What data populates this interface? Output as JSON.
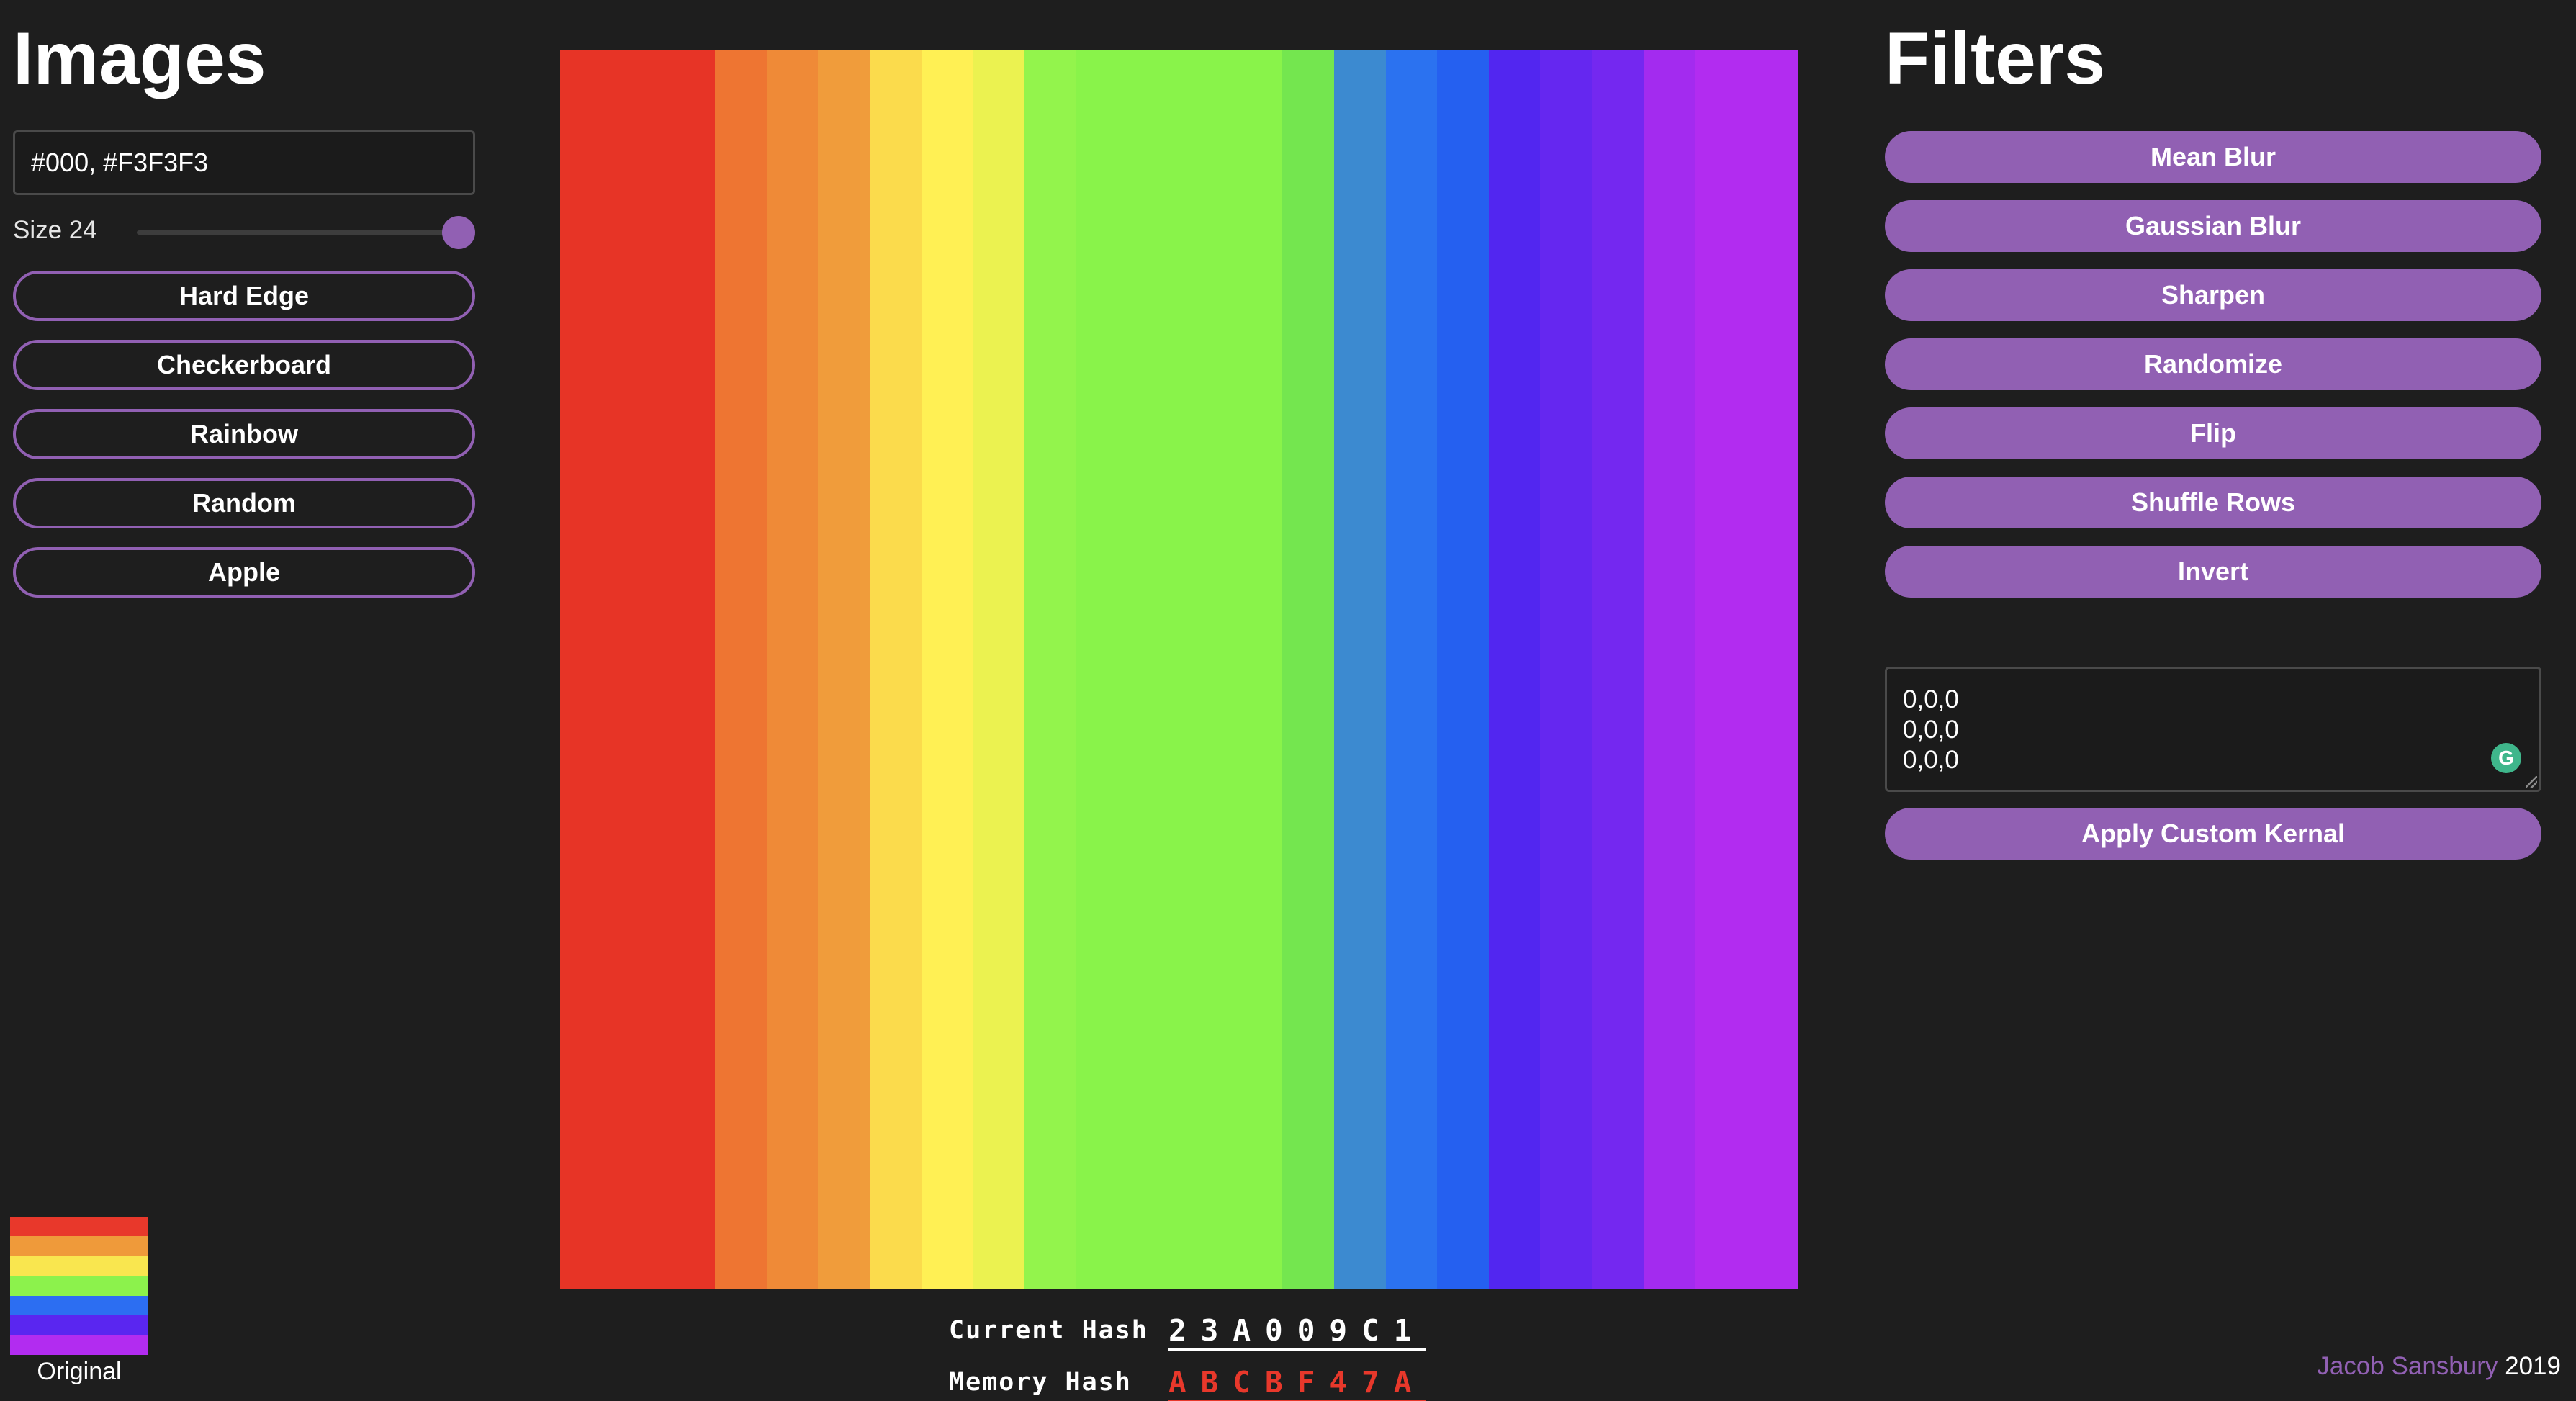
{
  "images_panel": {
    "title": "Images",
    "color_input_value": "#000, #F3F3F3",
    "size_label": "Size 24",
    "size_value": 24,
    "size_max": 25,
    "size_min": 1,
    "buttons": {
      "hard_edge": "Hard Edge",
      "checkerboard": "Checkerboard",
      "rainbow": "Rainbow",
      "random": "Random",
      "apple": "Apple"
    }
  },
  "original": {
    "caption": "Original",
    "bands": [
      "#e8382b",
      "#ef9a3a",
      "#f9e64f",
      "#8cf24c",
      "#2c6ef2",
      "#5a26f0",
      "#b22cf0"
    ]
  },
  "canvas": {
    "columns": [
      "#e73426",
      "#e73426",
      "#e73426",
      "#ee7532",
      "#ef8a37",
      "#f09c3b",
      "#fbdb4c",
      "#fff054",
      "#ebf250",
      "#93f44c",
      "#89f34a",
      "#89f34a",
      "#89f34a",
      "#89f34a",
      "#74e64f",
      "#3c8ad0",
      "#2b72f0",
      "#2560f0",
      "#5226f0",
      "#6527f0",
      "#7428f0",
      "#a32bef",
      "#b22cf0",
      "#b22cf0"
    ]
  },
  "hashes": {
    "current_label": "Current Hash",
    "current_value": "23A009C1",
    "current_color": "#ffffff",
    "memory_label": "Memory Hash",
    "memory_value": "ABCBF47A",
    "memory_color": "#e8382b"
  },
  "filters_panel": {
    "title": "Filters",
    "buttons": {
      "mean_blur": "Mean Blur",
      "gaussian_blur": "Gaussian Blur",
      "sharpen": "Sharpen",
      "randomize": "Randomize",
      "flip": "Flip",
      "shuffle_rows": "Shuffle Rows",
      "invert": "Invert"
    },
    "kernel_value": "0,0,0\n0,0,0\n0,0,0",
    "grammar_icon": "G",
    "apply_kernel": "Apply Custom Kernal"
  },
  "credit": {
    "name": "Jacob Sansbury",
    "year": "2019",
    "name_color": "#9160b3"
  },
  "colors": {
    "background": "#1e1e1e",
    "accent": "#9160b3"
  }
}
